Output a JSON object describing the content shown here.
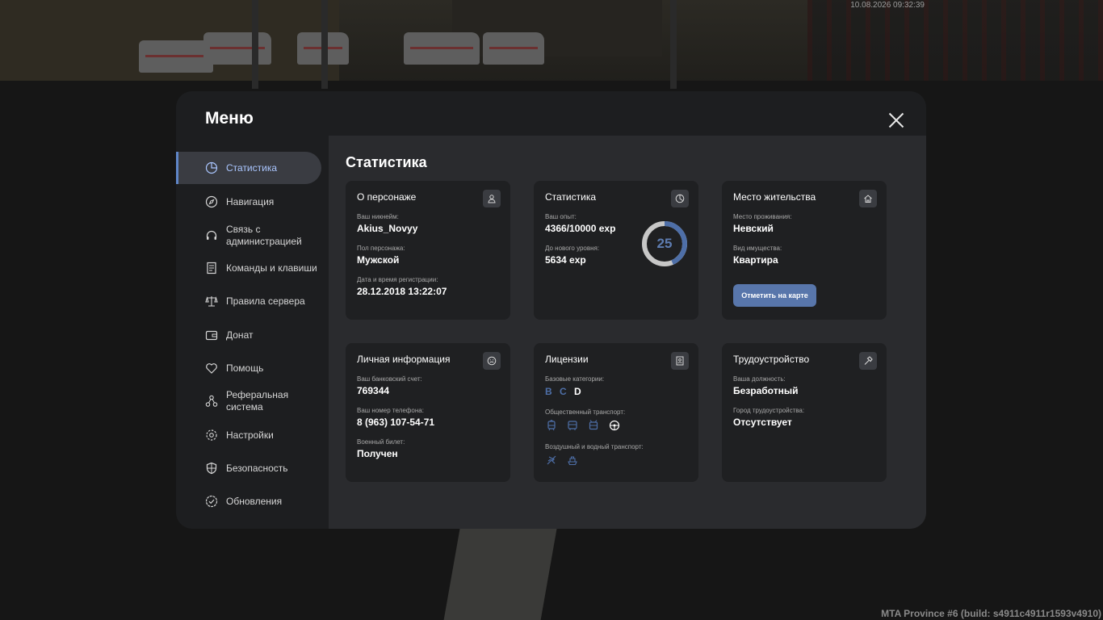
{
  "hud": {
    "timestamp": "10.08.2026 09:32:39",
    "build": "MTA Province #6 (build: s4911c4911r1593v4910)"
  },
  "menu": {
    "title": "Меню",
    "close_icon": "close-icon"
  },
  "sidebar": {
    "items": [
      {
        "label": "Статистика",
        "icon": "pie-chart-icon",
        "active": true
      },
      {
        "label": "Навигация",
        "icon": "compass-icon"
      },
      {
        "label": "Связь с администрацией",
        "icon": "headset-icon"
      },
      {
        "label": "Команды и клавиши",
        "icon": "document-icon"
      },
      {
        "label": "Правила сервера",
        "icon": "scales-icon"
      },
      {
        "label": "Донат",
        "icon": "wallet-icon"
      },
      {
        "label": "Помощь",
        "icon": "heart-hand-icon"
      },
      {
        "label": "Реферальная система",
        "icon": "network-icon"
      },
      {
        "label": "Настройки",
        "icon": "gear-icon"
      },
      {
        "label": "Безопасность",
        "icon": "shield-icon"
      },
      {
        "label": "Обновления",
        "icon": "check-badge-icon"
      }
    ]
  },
  "content": {
    "title": "Статистика",
    "cards": {
      "character": {
        "title": "О персонаже",
        "icon": "user-icon",
        "nickname_label": "Ваш никнейм:",
        "nickname": "Akius_Novyy",
        "gender_label": "Пол персонажа:",
        "gender": "Мужской",
        "reg_label": "Дата и время регистрации:",
        "reg_date": "28.12.2018 13:22:07"
      },
      "stats": {
        "title": "Статистика",
        "icon": "chart-icon",
        "exp_label": "Ваш опыт:",
        "exp": "4366/10000 exp",
        "next_label": "До нового уровня:",
        "next": "5634 exp",
        "level": "25",
        "progress": 0.4366
      },
      "residence": {
        "title": "Место жительства",
        "icon": "home-icon",
        "place_label": "Место проживания:",
        "place": "Невский",
        "property_label": "Вид имущества:",
        "property": "Квартира",
        "map_button": "Отметить на карте"
      },
      "personal": {
        "title": "Личная информация",
        "icon": "face-icon",
        "bank_label": "Ваш банковский счет:",
        "bank": "769344",
        "phone_label": "Ваш номер телефона:",
        "phone": "8 (963) 107-54-71",
        "military_label": "Военный билет:",
        "military": "Получен"
      },
      "licenses": {
        "title": "Лицензии",
        "icon": "id-card-icon",
        "base_label": "Базовые категории:",
        "categories": [
          "B",
          "C",
          "D"
        ],
        "public_label": "Общественный транспорт:",
        "public_icons": [
          "tram-icon",
          "bus-icon",
          "trolleybus-icon",
          "steering-wheel-icon"
        ],
        "air_label": "Воздушный и водный транспорт:",
        "air_icons": [
          "airplane-icon",
          "boat-icon"
        ],
        "colors": {
          "active": "#4e6fa8",
          "inactive": "#ffffff"
        }
      },
      "job": {
        "title": "Трудоустройство",
        "icon": "hammer-icon",
        "position_label": "Ваша должность:",
        "position": "Безработный",
        "city_label": "Город трудоустройства:",
        "city": "Отсутствует"
      }
    }
  },
  "colors": {
    "accent": "#5f86c8",
    "button": "#5876ab",
    "card_bg": "#1f2022"
  }
}
